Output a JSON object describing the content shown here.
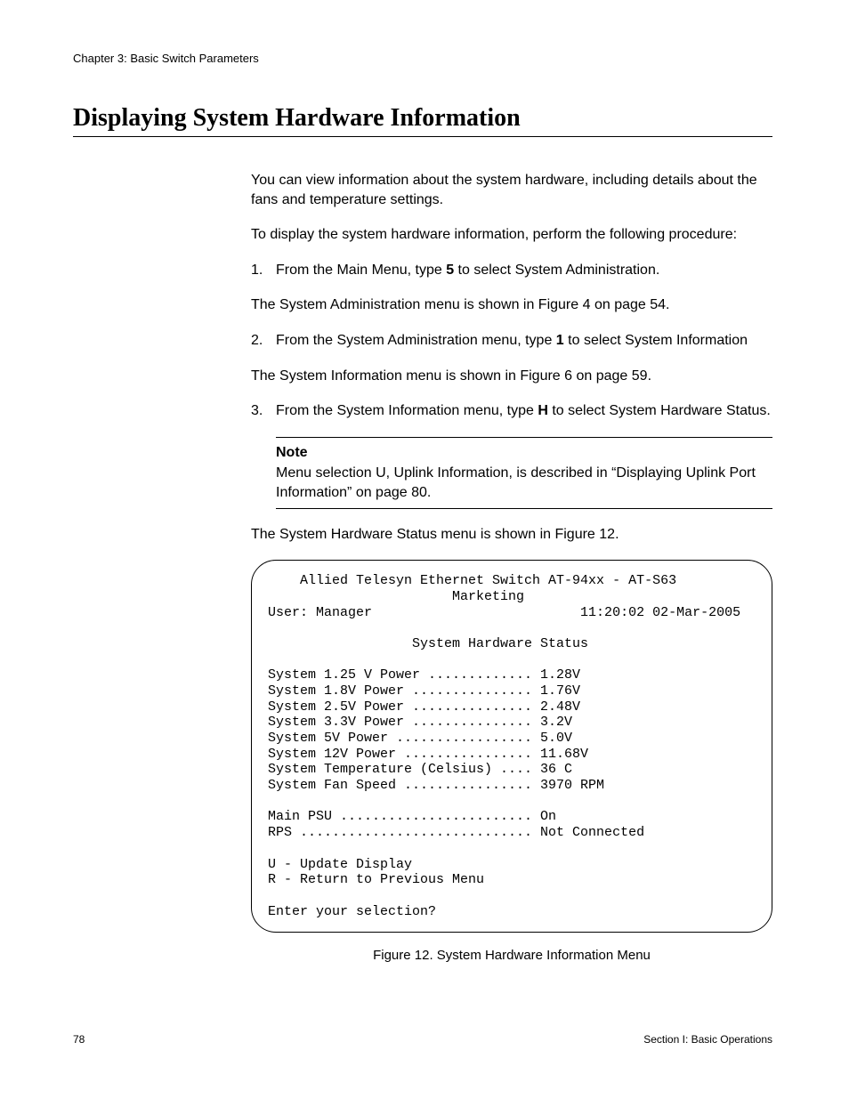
{
  "chapter_header": "Chapter 3: Basic Switch Parameters",
  "section_title": "Displaying System Hardware Information",
  "intro_para": "You can view information about the system hardware, including details about the fans and temperature settings.",
  "lead_para": "To display the system hardware information, perform the following procedure:",
  "steps": {
    "s1": {
      "num": "1.",
      "pre": "From the Main Menu, type ",
      "bold": "5",
      "post": " to select System Administration.",
      "follow": "The System Administration menu is shown in Figure 4 on page 54."
    },
    "s2": {
      "num": "2.",
      "pre": "From the System Administration menu, type ",
      "bold": "1",
      "post": " to select System Information",
      "follow": "The System Information menu is shown in Figure 6 on page 59."
    },
    "s3": {
      "num": "3.",
      "pre": "From the System Information menu, type ",
      "bold": "H",
      "post": " to select System Hardware Status."
    }
  },
  "note": {
    "label": "Note",
    "text": "Menu selection U, Uplink Information, is described in “Displaying Uplink Port Information” on page 80."
  },
  "after_note": "The System Hardware Status menu is shown in Figure 12.",
  "terminal": "    Allied Telesyn Ethernet Switch AT-94xx - AT-S63\n                       Marketing\nUser: Manager                          11:20:02 02-Mar-2005\n\n                  System Hardware Status\n\nSystem 1.25 V Power ............. 1.28V\nSystem 1.8V Power ............... 1.76V\nSystem 2.5V Power ............... 2.48V\nSystem 3.3V Power ............... 3.2V\nSystem 5V Power ................. 5.0V\nSystem 12V Power ................ 11.68V\nSystem Temperature (Celsius) .... 36 C\nSystem Fan Speed ................ 3970 RPM\n\nMain PSU ........................ On\nRPS ............................. Not Connected\n\nU - Update Display\nR - Return to Previous Menu\n\nEnter your selection?",
  "figure_caption": "Figure 12. System Hardware Information Menu",
  "footer": {
    "page_number": "78",
    "section_label": "Section I: Basic Operations"
  }
}
